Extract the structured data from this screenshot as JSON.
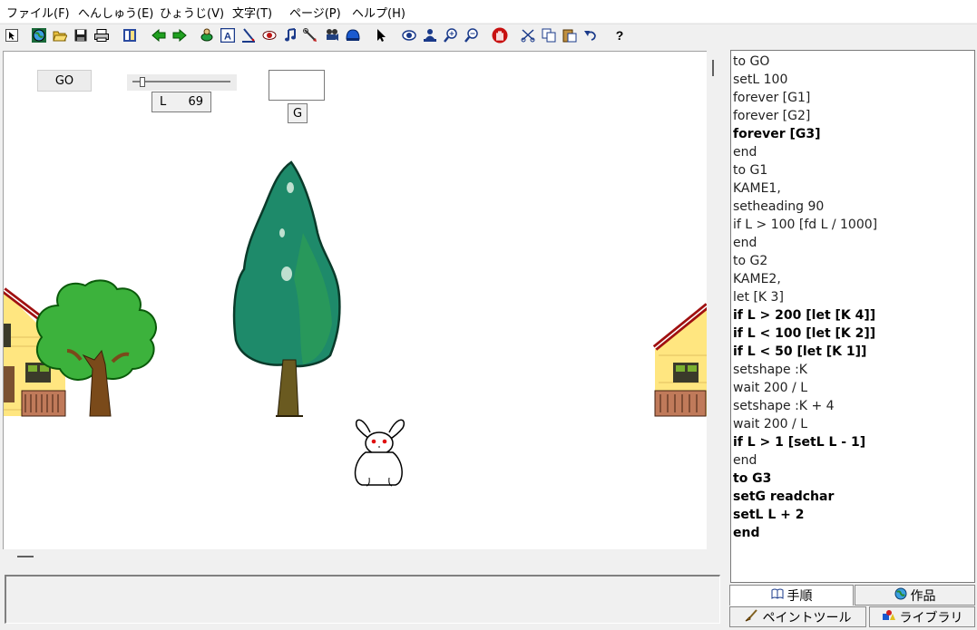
{
  "menu": [
    "ファイル(F)",
    "へんしゅう(E)",
    "ひょうじ(V)",
    "文字(T)",
    "ページ(P)",
    "ヘルプ(H)"
  ],
  "toolbar_icons": [
    "pointer-icon",
    "globe-icon",
    "open-folder-icon",
    "save-icon",
    "print-icon",
    "book-icon",
    "arrow-left-icon",
    "arrow-right-icon",
    "turtle-icon",
    "text-box-icon",
    "pen-icon",
    "eye-icon",
    "music-note-icon",
    "wrench-icon",
    "projector-icon",
    "helmet-icon",
    "cursor-icon",
    "show-icon",
    "person-icon",
    "zoom-in-icon",
    "zoom-out-icon",
    "stop-hand-icon",
    "cut-icon",
    "copy-icon",
    "paste-icon",
    "undo-icon",
    "help-icon"
  ],
  "stage": {
    "go_button": "GO",
    "slider": {
      "label": "L",
      "value": "69",
      "level_fraction": 0.1
    },
    "text_box": "",
    "g_button": "G"
  },
  "script": {
    "lines": [
      {
        "text": "to GO",
        "bold": false
      },
      {
        "text": "setL 100",
        "bold": false
      },
      {
        "text": "forever [G1]",
        "bold": false
      },
      {
        "text": "forever [G2]",
        "bold": false
      },
      {
        "text": "forever [G3]",
        "bold": true
      },
      {
        "text": "end",
        "bold": false
      },
      {
        "text": "to G1",
        "bold": false
      },
      {
        "text": "KAME1,",
        "bold": false
      },
      {
        "text": "setheading 90",
        "bold": false
      },
      {
        "text": "if L > 100 [fd L / 1000]",
        "bold": false
      },
      {
        "text": "end",
        "bold": false
      },
      {
        "text": "to G2",
        "bold": false
      },
      {
        "text": "KAME2,",
        "bold": false
      },
      {
        "text": "let [K 3]",
        "bold": false
      },
      {
        "text": "if L > 200 [let [K 4]]",
        "bold": true
      },
      {
        "text": "if L < 100 [let [K 2]]",
        "bold": true
      },
      {
        "text": "if L < 50 [let [K 1]]",
        "bold": true
      },
      {
        "text": "setshape :K",
        "bold": false
      },
      {
        "text": "wait 200 / L",
        "bold": false
      },
      {
        "text": "setshape :K + 4",
        "bold": false
      },
      {
        "text": "wait 200 / L",
        "bold": false
      },
      {
        "text": "if L > 1 [setL L - 1]",
        "bold": true
      },
      {
        "text": "end",
        "bold": false
      },
      {
        "text": "to G3",
        "bold": true
      },
      {
        "text": "setG readchar",
        "bold": true
      },
      {
        "text": "setL L + 2",
        "bold": true
      },
      {
        "text": "end",
        "bold": true
      }
    ]
  },
  "tabs": {
    "tejun": "手順",
    "sakuhin": "作品",
    "paint_tool": "ペイントツール",
    "library": "ライブラリ"
  },
  "colors": {
    "tree_green": "#1e8a6a",
    "bush_green": "#3cb23c",
    "house_yellow": "#ffe680",
    "roof_red": "#a01010",
    "rabbit_eye": "#e01010"
  }
}
